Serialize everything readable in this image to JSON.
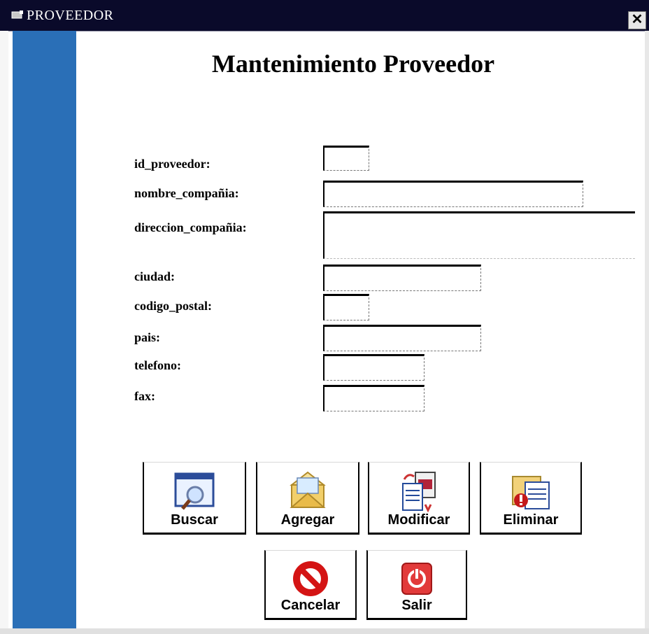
{
  "window": {
    "title": "PROVEEDOR",
    "close_label": "✕"
  },
  "form": {
    "heading": "Mantenimiento Proveedor",
    "fields": {
      "id_proveedor": {
        "label": "id_proveedor:",
        "value": ""
      },
      "nombre_compania": {
        "label": "nombre_compañia:",
        "value": ""
      },
      "direccion_compania": {
        "label": "direccion_compañia:",
        "value": ""
      },
      "ciudad": {
        "label": "ciudad:",
        "value": ""
      },
      "codigo_postal": {
        "label": "codigo_postal:",
        "value": ""
      },
      "pais": {
        "label": "pais:",
        "value": ""
      },
      "telefono": {
        "label": "telefono:",
        "value": ""
      },
      "fax": {
        "label": "fax:",
        "value": ""
      }
    }
  },
  "buttons": {
    "buscar": {
      "label": "Buscar",
      "icon": "search-window-icon"
    },
    "agregar": {
      "label": "Agregar",
      "icon": "open-envelope-icon"
    },
    "modificar": {
      "label": "Modificar",
      "icon": "edit-documents-icon"
    },
    "eliminar": {
      "label": "Eliminar",
      "icon": "delete-document-icon"
    },
    "cancelar": {
      "label": "Cancelar",
      "icon": "no-entry-icon"
    },
    "salir": {
      "label": "Salir",
      "icon": "power-icon"
    }
  },
  "colors": {
    "titlebar": "#0a0a2a",
    "sidebar": "#2a6fb7",
    "window_bg": "#ffffff"
  }
}
